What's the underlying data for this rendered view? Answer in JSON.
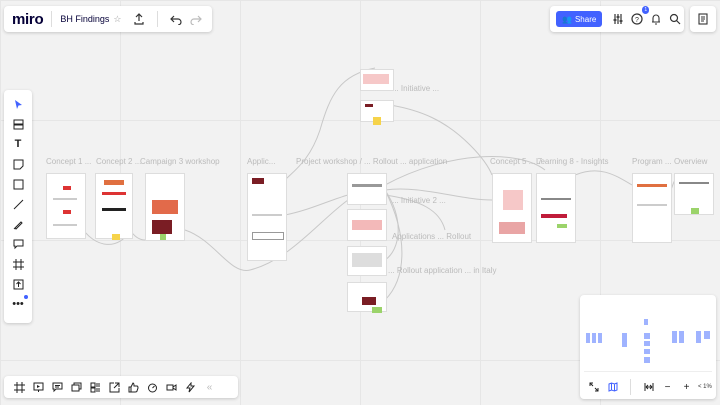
{
  "app": {
    "logo": "miro",
    "board_name": "BH Findings",
    "star_icon": "star-icon"
  },
  "share": {
    "label": "Share"
  },
  "help_badge": {
    "count": "1"
  },
  "frame_labels": {
    "f1": "Concept 1 ...",
    "f2": "Concept 2 ...",
    "f3": "Campaign 3 workshop",
    "f4": "Applic...",
    "f5": "Project workshop / ... Rollout ... application",
    "f6": "Concept 5 ... 7",
    "f7": "Learning 8 - Insights",
    "f8": "Program ...",
    "f9": "Overview",
    "n1": "... Initiative ...",
    "n2": "... Initiative 2 ...",
    "n3": "Applications ... Rollout",
    "n4": "... Rollout application ... in Italy"
  },
  "minimap": {
    "zoom": "< 1%"
  },
  "colors": {
    "accent": "#4262ff",
    "canvas": "#f2f2f2"
  }
}
